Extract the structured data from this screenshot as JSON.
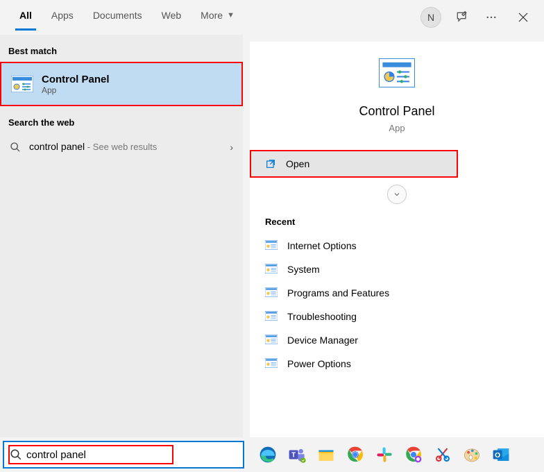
{
  "tabs": {
    "all": "All",
    "apps": "Apps",
    "documents": "Documents",
    "web": "Web",
    "more": "More"
  },
  "avatar_initial": "N",
  "left": {
    "best_match_header": "Best match",
    "best_match": {
      "title": "Control Panel",
      "sub": "App"
    },
    "search_web_header": "Search the web",
    "web_result": {
      "query": "control panel",
      "sub": " - See web results"
    }
  },
  "detail": {
    "title": "Control Panel",
    "sub": "App",
    "open_label": "Open",
    "recent_header": "Recent",
    "recent": [
      "Internet Options",
      "System",
      "Programs and Features",
      "Troubleshooting",
      "Device Manager",
      "Power Options"
    ]
  },
  "search": {
    "value": "control panel"
  },
  "taskbar": [
    "edge",
    "teams",
    "file-explorer",
    "chrome",
    "slack",
    "chrome-canary",
    "snip",
    "paint",
    "outlook"
  ]
}
